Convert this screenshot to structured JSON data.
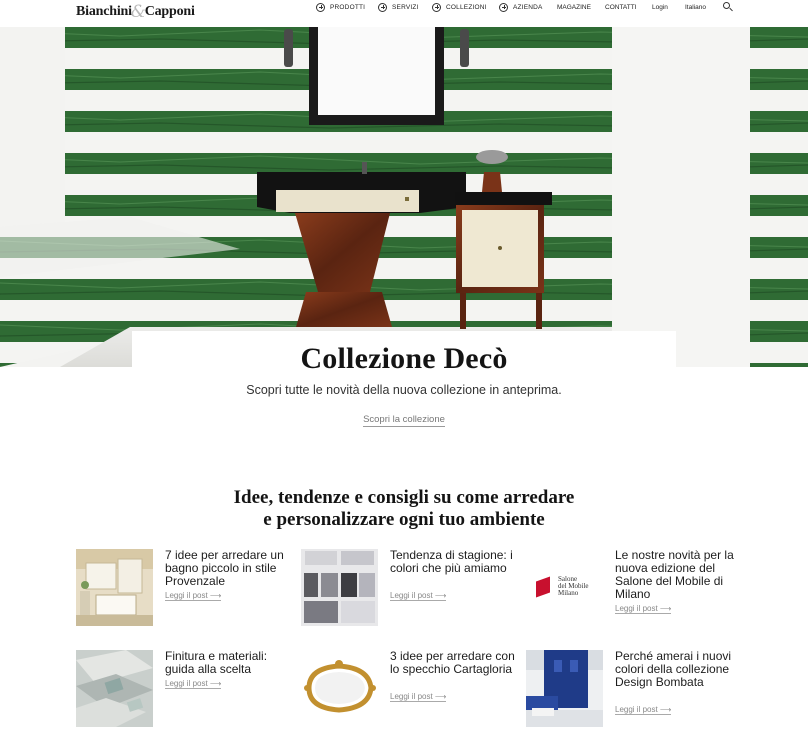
{
  "brand": {
    "name_left": "Bianchini",
    "amp": "&",
    "name_right": "Capponi"
  },
  "nav": {
    "items_plus": [
      "PRODOTTI",
      "SERVIZI",
      "COLLEZIONI",
      "AZIENDA"
    ],
    "items_plain": [
      "MAGAZINE",
      "CONTATTI",
      "Login",
      "Italiano"
    ]
  },
  "hero": {
    "prev_arrow": "‹",
    "next_arrow": "›",
    "title": "Collezione Decò",
    "subtitle": "Scopri tutte le novità della nuova collezione in anteprima.",
    "link": "Scopri la collezione"
  },
  "section": {
    "title_line1": "Idee, tendenze e consigli su come arredare",
    "title_line2": "e personalizzare ogni tuo ambiente"
  },
  "posts": [
    {
      "title": "7 idee per arredare un bagno piccolo in stile Provenzale",
      "link": "Leggi il post ⟶"
    },
    {
      "title": "Tendenza di stagione: i colori che più amiamo",
      "link": "Leggi il post ⟶"
    },
    {
      "title": "Le nostre novità per la nuova edizione del Salone del Mobile di Milano",
      "link": "Leggi il post ⟶"
    },
    {
      "title": "Finitura e materiali: guida alla scelta",
      "link": "Leggi il post ⟶"
    },
    {
      "title": "3 idee per arredare con lo specchio Cartagloria",
      "link": "Leggi il post ⟶"
    },
    {
      "title": "Perché amerai i nuovi colori della collezione Design Bombata",
      "link": "Leggi il post ⟶"
    }
  ],
  "salone_logo": {
    "line1": "Salone",
    "line2": "del Mobile",
    "line3": "Milano"
  },
  "colors": {
    "marble_green": "#2f6b34",
    "marble_dark": "#1d4a22",
    "accent_red": "#c8102e",
    "wood": "#6b2e18"
  }
}
